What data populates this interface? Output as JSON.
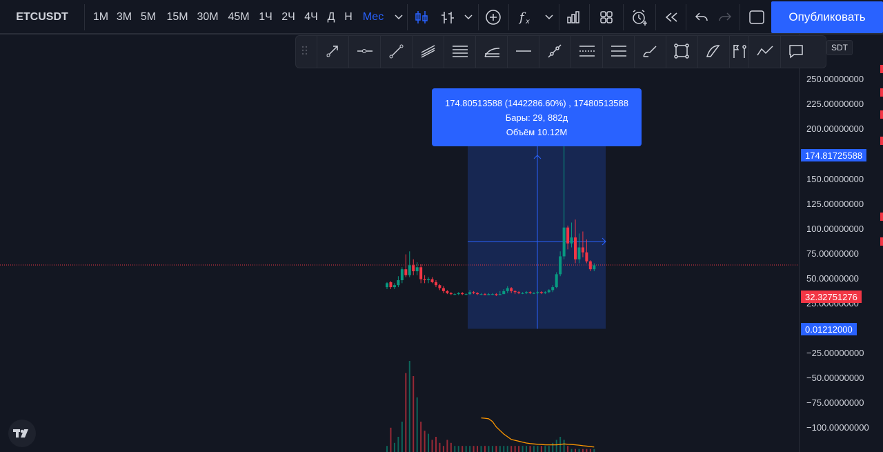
{
  "toolbar": {
    "symbol": "ETCUSDT",
    "intervals": [
      "1М",
      "3М",
      "5М",
      "15М",
      "30М",
      "45М",
      "1Ч",
      "2Ч",
      "4Ч",
      "Д",
      "Н",
      "Мес"
    ],
    "active_interval": "Мес",
    "publish_label": "Опубликовать"
  },
  "drawing_tools": [
    "drag-handle",
    "arrow-line",
    "horizontal-ray",
    "trend-line",
    "parallel-channel",
    "pitchfork",
    "fib-channel",
    "horizontal-line",
    "cross-line",
    "price-range",
    "date-range",
    "brush",
    "rectangle",
    "curve",
    "flag-marker",
    "path",
    "callout"
  ],
  "price_axis": {
    "currency_tag": "SDT",
    "labels": [
      "250.00000000",
      "225.00000000",
      "200.00000000",
      "150.00000000",
      "125.00000000",
      "100.00000000",
      "75.00000000",
      "50.00000000",
      "25.00000000",
      "−25.00000000",
      "−50.00000000",
      "−75.00000000",
      "−100.00000000"
    ],
    "target_price": "174.81725588",
    "last_price": "32.32751276",
    "base_price": "0.01212000",
    "colors": {
      "accent": "#2962ff",
      "last": "#f23645",
      "up": "#089981",
      "down": "#f23645",
      "ma": "#ff9800"
    }
  },
  "measure_tooltip": {
    "line1": "174.80513588 (1442286.60%) , 17480513588",
    "line2": "Бары: 29, 882д",
    "line3": "Объём 10.12M"
  },
  "chart_data": {
    "type": "candlestick",
    "candles": [
      [
        10,
        14,
        8,
        15
      ],
      [
        15,
        10,
        8,
        16
      ],
      [
        10,
        12,
        8,
        14
      ],
      [
        12,
        17,
        10,
        21
      ],
      [
        17,
        28,
        14,
        30
      ],
      [
        28,
        22,
        20,
        43
      ],
      [
        22,
        32,
        20,
        46
      ],
      [
        32,
        26,
        22,
        38
      ],
      [
        26,
        30,
        22,
        35
      ],
      [
        30,
        18,
        14,
        33
      ],
      [
        18,
        17,
        14,
        22
      ],
      [
        17,
        18,
        14,
        20
      ],
      [
        18,
        15,
        14,
        20
      ],
      [
        15,
        12,
        10,
        17
      ],
      [
        12,
        9,
        7,
        13
      ],
      [
        9,
        6,
        4,
        11
      ],
      [
        6,
        4,
        3,
        7
      ],
      [
        4,
        3,
        2,
        5
      ],
      [
        3,
        3,
        2,
        4
      ],
      [
        3,
        4,
        2,
        5
      ],
      [
        4,
        3,
        2,
        5
      ],
      [
        3,
        3,
        2,
        4
      ],
      [
        3,
        5,
        2,
        7
      ],
      [
        5,
        4,
        3,
        6
      ],
      [
        4,
        3,
        2,
        5
      ],
      [
        3,
        3,
        2,
        4
      ],
      [
        3,
        2,
        2,
        4
      ],
      [
        2,
        3,
        2,
        4
      ],
      [
        3,
        3,
        2,
        4
      ],
      [
        3,
        2,
        1,
        4
      ],
      [
        2,
        3,
        2,
        6
      ],
      [
        3,
        6,
        3,
        8
      ],
      [
        6,
        9,
        4,
        11
      ],
      [
        9,
        6,
        4,
        10
      ],
      [
        6,
        5,
        3,
        7
      ],
      [
        5,
        4,
        3,
        6
      ],
      [
        4,
        4,
        3,
        5
      ],
      [
        4,
        5,
        3,
        6
      ],
      [
        5,
        4,
        3,
        6
      ],
      [
        4,
        4,
        3,
        5
      ],
      [
        4,
        5,
        3,
        6
      ],
      [
        5,
        4,
        3,
        6
      ],
      [
        4,
        5,
        3,
        6
      ],
      [
        5,
        7,
        4,
        8
      ],
      [
        7,
        10,
        5,
        12
      ],
      [
        10,
        23,
        9,
        25
      ],
      [
        23,
        41,
        21,
        46
      ],
      [
        41,
        70,
        38,
        175
      ],
      [
        70,
        54,
        48,
        72
      ],
      [
        54,
        60,
        50,
        75
      ],
      [
        60,
        38,
        34,
        78
      ],
      [
        38,
        50,
        34,
        64
      ],
      [
        50,
        45,
        40,
        66
      ],
      [
        45,
        36,
        34,
        58
      ],
      [
        36,
        28,
        26,
        37
      ],
      [
        28,
        32,
        26,
        34
      ]
    ],
    "volume": [
      2,
      8,
      3,
      5,
      10,
      26,
      30,
      25,
      18,
      10,
      7,
      6,
      4,
      5,
      3,
      2,
      4,
      3,
      2,
      2,
      2,
      2,
      2,
      2,
      2,
      2,
      2,
      2,
      2,
      2,
      2,
      2,
      2,
      2,
      2,
      2,
      2,
      2,
      2,
      2,
      2,
      2,
      2,
      2,
      3,
      4,
      5,
      4,
      2,
      1,
      1,
      1,
      1,
      1,
      1,
      1
    ],
    "ma": [
      null,
      null,
      null,
      null,
      null,
      null,
      null,
      null,
      null,
      null,
      null,
      null,
      null,
      null,
      null,
      null,
      null,
      null,
      null,
      null,
      null,
      null,
      null,
      null,
      null,
      19,
      18.8,
      18.5,
      17,
      14,
      12,
      10,
      8.5,
      7,
      6.5,
      6,
      5.5,
      5,
      4.7,
      4.5,
      4.3,
      4.2,
      4,
      4,
      4,
      4,
      4.2,
      4.5,
      4.3,
      4.2,
      4,
      3.8,
      3.5,
      3.3,
      3,
      2.8
    ],
    "measured_range": {
      "from_price": 0.01212,
      "to_price": 174.81725588,
      "bars": 29,
      "days": 882
    },
    "ylim": [
      -105,
      265
    ],
    "last_price": 32.32751276
  }
}
